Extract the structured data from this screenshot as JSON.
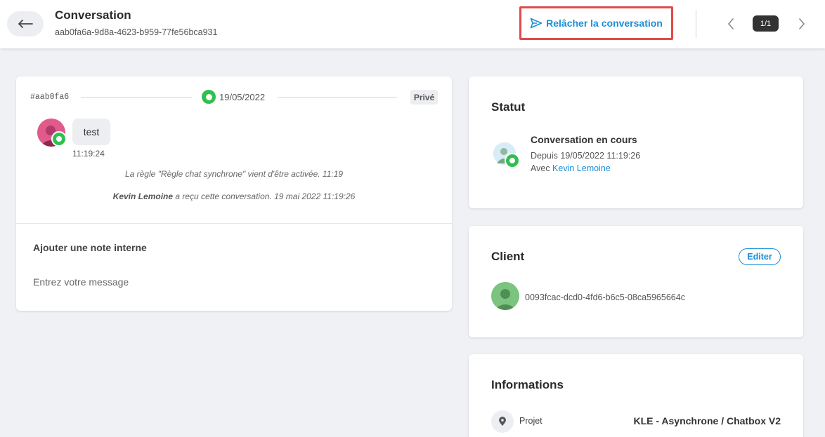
{
  "header": {
    "title": "Conversation",
    "conversation_uuid": "aab0fa6a-9d8a-4623-b959-77fe56bca931",
    "release_label": "Relâcher la conversation",
    "page_indicator": "1/1"
  },
  "conversation": {
    "short_id": "#aab0fa6",
    "date": "19/05/2022",
    "visibility": "Privé",
    "messages": [
      {
        "text": "test",
        "time": "11:19:24"
      }
    ],
    "events": [
      {
        "text": "La règle \"Règle chat synchrone\" vient d'être activée.   11:19"
      },
      {
        "agent": "Kevin Lemoine",
        "text": " a reçu cette conversation. 19 mai 2022 11:19:26"
      }
    ],
    "note_label": "Ajouter une note interne",
    "note_placeholder": "Entrez votre message"
  },
  "statut": {
    "title": "Statut",
    "status": "Conversation en cours",
    "since": "Depuis 19/05/2022 11:19:26",
    "with_prefix": "Avec ",
    "agent": "Kevin Lemoine"
  },
  "client": {
    "title": "Client",
    "edit_label": "Editer",
    "client_id": "0093fcac-dcd0-4fd6-b6c5-08ca5965664c"
  },
  "informations": {
    "title": "Informations",
    "project_label": "Projet",
    "project_value": "KLE - Asynchrone / Chatbox V2"
  },
  "colors": {
    "accent": "#1a8fd6",
    "highlight_border": "#e04a4a",
    "online_green": "#2fbf4f"
  }
}
